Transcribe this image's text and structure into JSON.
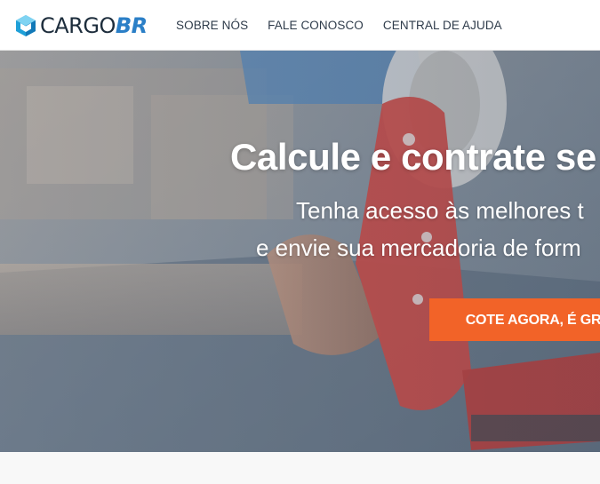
{
  "brand": {
    "name_part1": "CARGO",
    "name_part2": "BR",
    "accent_color": "#2b7fc7",
    "icon": "cube-logo-icon"
  },
  "nav": {
    "items": [
      {
        "label": "SOBRE NÓS"
      },
      {
        "label": "FALE CONOSCO"
      },
      {
        "label": "CENTRAL DE AJUDA"
      }
    ]
  },
  "hero": {
    "title": "Calcule e contrate se",
    "subtitle_line1": "Tenha acesso às melhores t",
    "subtitle_line2": "e envie sua mercadoria de form",
    "cta_label": "COTE AGORA, É GRÁT",
    "cta_color": "#f26328"
  }
}
